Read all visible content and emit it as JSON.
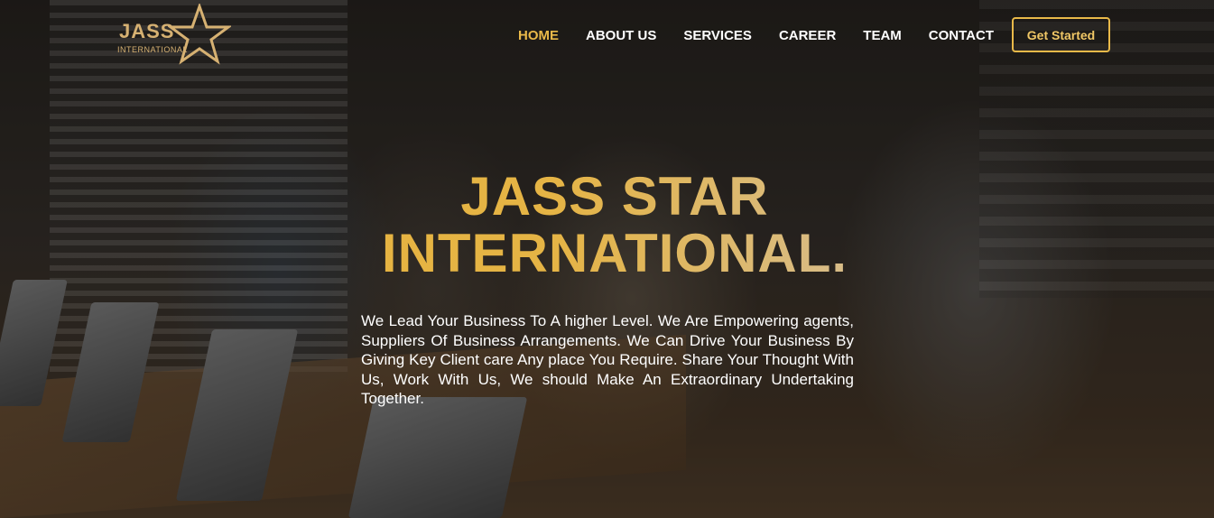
{
  "brand": {
    "logo_line1": "JASS",
    "logo_line2": "INTERNATIONAL",
    "accent_color": "#e9b949"
  },
  "nav": {
    "items": [
      {
        "label": "HOME",
        "active": true
      },
      {
        "label": "ABOUT US",
        "active": false
      },
      {
        "label": "SERVICES",
        "active": false
      },
      {
        "label": "CAREER",
        "active": false
      },
      {
        "label": "TEAM",
        "active": false
      },
      {
        "label": "CONTACT",
        "active": false
      }
    ],
    "cta_label": "Get Started"
  },
  "hero": {
    "title_line1": "JASS STAR",
    "title_line2": "INTERNATIONAL.",
    "description": "We Lead Your Business To A higher Level. We Are Empowering agents, Suppliers Of Business Arrangements. We Can Drive Your Business By Giving Key Client care Any place You Require. Share Your Thought With Us, Work With Us, We should Make An Extraordinary Undertaking Together."
  }
}
